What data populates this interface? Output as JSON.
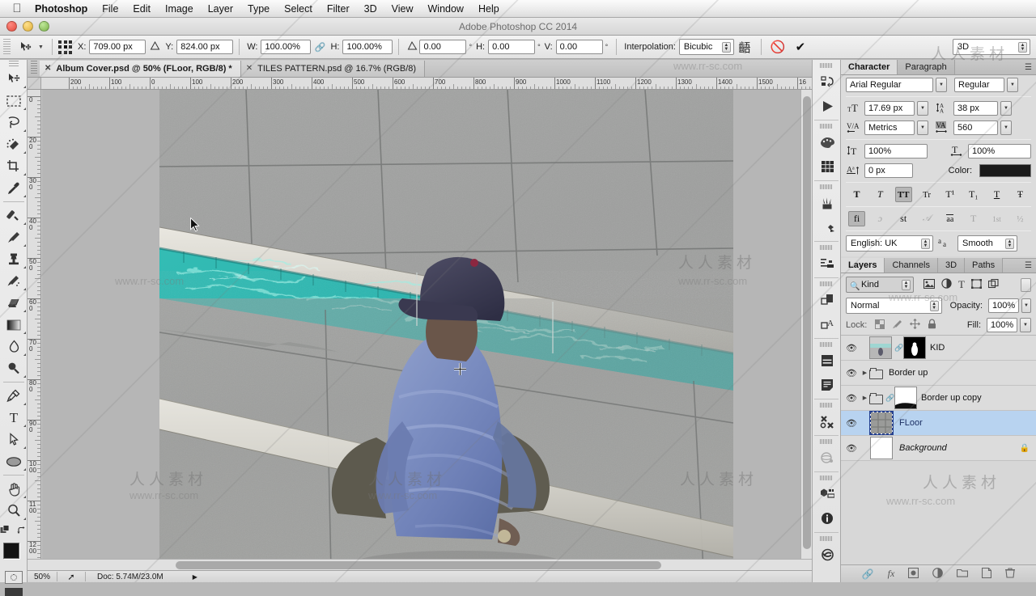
{
  "menubar": {
    "apple_icon": "apple-icon",
    "items": [
      {
        "label": "Photoshop",
        "bold": true
      },
      {
        "label": "File"
      },
      {
        "label": "Edit"
      },
      {
        "label": "Image"
      },
      {
        "label": "Layer"
      },
      {
        "label": "Type"
      },
      {
        "label": "Select"
      },
      {
        "label": "Filter"
      },
      {
        "label": "3D"
      },
      {
        "label": "View"
      },
      {
        "label": "Window"
      },
      {
        "label": "Help"
      }
    ]
  },
  "titlebar": {
    "app_title": "Adobe Photoshop CC 2014"
  },
  "options_bar": {
    "tool_icon": "move-tool-icon",
    "reference_point_icon": "reference-point-grid-icon",
    "x_label": "X:",
    "x_value": "709.00 px",
    "delta_icon": "delta-triangle-icon",
    "y_label": "Y:",
    "y_value": "824.00 px",
    "w_label": "W:",
    "w_value": "100.00%",
    "link_icon": "chain-link-icon",
    "h_label": "H:",
    "h_value": "100.00%",
    "angle_icon": "angle-icon",
    "angle_value": "0.00",
    "degree_symbol": "°",
    "skew_h_label": "H:",
    "skew_h_value": "0.00",
    "skew_v_label": "V:",
    "skew_v_value": "0.00",
    "interpolation_label": "Interpolation:",
    "interpolation_value": "Bicubic",
    "warp_icon": "warp-mode-icon",
    "cancel_icon": "cancel-transform-icon",
    "commit_icon": "commit-transform-icon",
    "workspace_label": "3D"
  },
  "toolbar": {
    "tools": [
      {
        "name": "move-tool",
        "icon": "move-arrow-icon"
      },
      {
        "name": "marquee-tool",
        "icon": "rect-marquee-icon"
      },
      {
        "name": "lasso-tool",
        "icon": "lasso-icon"
      },
      {
        "name": "quick-selection-tool",
        "icon": "quick-selection-icon"
      },
      {
        "name": "crop-tool",
        "icon": "crop-icon"
      },
      {
        "name": "eyedropper-tool",
        "icon": "eyedropper-icon"
      },
      {
        "name": "healing-brush-tool",
        "icon": "healing-brush-icon"
      },
      {
        "name": "brush-tool",
        "icon": "brush-icon"
      },
      {
        "name": "clone-stamp-tool",
        "icon": "clone-stamp-icon"
      },
      {
        "name": "history-brush-tool",
        "icon": "history-brush-icon"
      },
      {
        "name": "eraser-tool",
        "icon": "eraser-icon"
      },
      {
        "name": "gradient-tool",
        "icon": "gradient-icon"
      },
      {
        "name": "blur-tool",
        "icon": "blur-droplet-icon"
      },
      {
        "name": "dodge-tool",
        "icon": "dodge-icon"
      },
      {
        "name": "pen-tool",
        "icon": "pen-icon"
      },
      {
        "name": "type-tool",
        "icon": "type-T-icon"
      },
      {
        "name": "path-selection-tool",
        "icon": "path-arrow-icon"
      },
      {
        "name": "ellipse-tool",
        "icon": "ellipse-shape-icon"
      },
      {
        "name": "hand-tool",
        "icon": "hand-icon"
      },
      {
        "name": "zoom-tool",
        "icon": "magnifier-icon"
      }
    ],
    "edit_toolbar_icon": "edit-toolbar-icon",
    "swap_colors_icon": "swap-colors-icon",
    "foreground_color": "#131313",
    "background_color": "#ffffff",
    "quick_mask_icon": "quick-mask-icon",
    "screen_mode_icon": "screen-mode-icon"
  },
  "document": {
    "tabs": [
      {
        "title": "Album Cover.psd @ 50% (FLoor, RGB/8) *",
        "active": true,
        "close_icon": "close-tab-icon"
      },
      {
        "title": "TILES PATTERN.psd @ 16.7% (RGB/8)",
        "active": false,
        "close_icon": "close-tab-icon"
      }
    ],
    "ruler_top_labels": [
      "200",
      "100",
      "0",
      "100",
      "200",
      "300",
      "400",
      "500",
      "600",
      "700",
      "800",
      "900",
      "1000",
      "1100",
      "1200",
      "1300",
      "1400",
      "1500",
      "16"
    ],
    "ruler_left_labels": [
      "0",
      "200",
      "300",
      "400",
      "500",
      "600",
      "700",
      "800",
      "900",
      "1000",
      "1100",
      "1200"
    ],
    "status": {
      "zoom": "50%",
      "share_icon": "share-arrow-icon",
      "doc_info": "Doc: 5.74M/23.0M",
      "expand_icon": "status-expand-icon"
    },
    "cursor_icon": "arrow-cursor",
    "move_cursor_icon": "move-crosshair-cursor"
  },
  "icon_dock": {
    "icons": [
      {
        "name": "mini-bridge-icon"
      },
      {
        "name": "play-timeline-icon"
      },
      {
        "name": "color-palette-icon"
      },
      {
        "name": "swatches-grid-icon"
      },
      {
        "name": "brush-presets-icon"
      },
      {
        "name": "brush-tool-presets-icon"
      },
      {
        "name": "adjustments-icon"
      },
      {
        "name": "layer-comps-icon"
      },
      {
        "name": "character-styles-icon"
      },
      {
        "name": "properties-icon"
      },
      {
        "name": "notes-icon"
      },
      {
        "name": "tool-presets-icon"
      },
      {
        "name": "3d-orbit-icon"
      },
      {
        "name": "measurement-log-icon"
      },
      {
        "name": "info-icon"
      },
      {
        "name": "clone-source-icon"
      }
    ]
  },
  "character_panel": {
    "tabs": [
      {
        "label": "Character",
        "active": true
      },
      {
        "label": "Paragraph",
        "active": false
      }
    ],
    "menu_icon": "panel-menu-icon",
    "font_family": "Arial Regular",
    "font_style": "Regular",
    "font_size_icon": "font-size-icon",
    "font_size": "17.69 px",
    "leading_icon": "leading-icon",
    "leading": "38 px",
    "kerning_icon": "kerning-icon",
    "kerning": "Metrics",
    "tracking_icon": "tracking-icon",
    "tracking": "560",
    "vertical_scale_icon": "vertical-scale-icon",
    "vertical_scale": "100%",
    "horizontal_scale_icon": "horizontal-scale-icon",
    "horizontal_scale": "100%",
    "baseline_icon": "baseline-shift-icon",
    "baseline_shift": "0 px",
    "color_label": "Color:",
    "color_value": "#1a1a1a",
    "style_buttons": [
      {
        "name": "faux-bold",
        "glyph": "T",
        "active": false
      },
      {
        "name": "faux-italic",
        "glyph": "T",
        "active": false
      },
      {
        "name": "all-caps",
        "glyph": "TT",
        "active": true
      },
      {
        "name": "small-caps",
        "glyph": "Tr",
        "active": false
      },
      {
        "name": "superscript",
        "glyph": "T¹",
        "active": false
      },
      {
        "name": "subscript",
        "glyph": "T₁",
        "active": false
      },
      {
        "name": "underline",
        "glyph": "T",
        "active": false
      },
      {
        "name": "strikethrough",
        "glyph": "Ŧ",
        "active": false
      }
    ],
    "opentype_buttons": [
      {
        "name": "standard-ligatures",
        "glyph": "fi",
        "active": true
      },
      {
        "name": "contextual-alternates",
        "glyph": "ɔ",
        "active": false
      },
      {
        "name": "discretionary-ligatures",
        "glyph": "st",
        "active": false
      },
      {
        "name": "swash",
        "glyph": "𝒜",
        "active": false,
        "dim": true
      },
      {
        "name": "oldstyle",
        "glyph": "aa",
        "active": false
      },
      {
        "name": "stylistic-alternates",
        "glyph": "T",
        "active": false,
        "dim": true
      },
      {
        "name": "ordinals",
        "glyph": "1st",
        "active": false,
        "dim": true
      },
      {
        "name": "fractions",
        "glyph": "½",
        "active": false,
        "dim": true
      }
    ],
    "language": "English: UK",
    "antialias_icon": "anti-alias-icon",
    "antialias": "Smooth"
  },
  "layers_panel": {
    "tabs": [
      {
        "label": "Layers",
        "active": true
      },
      {
        "label": "Channels",
        "active": false
      },
      {
        "label": "3D",
        "active": false
      },
      {
        "label": "Paths",
        "active": false
      }
    ],
    "menu_icon": "panel-menu-icon",
    "filter_search_icon": "search-icon",
    "filter_kind": "Kind",
    "filter_icons": [
      "filter-pixel-icon",
      "filter-adjustment-icon",
      "filter-type-icon",
      "filter-shape-icon",
      "filter-smart-object-icon"
    ],
    "filter_toggle_icon": "filter-power-toggle-icon",
    "blend_mode": "Normal",
    "opacity_label": "Opacity:",
    "opacity_value": "100%",
    "lock_label": "Lock:",
    "lock_icons": [
      "lock-transparent-pixels-icon",
      "lock-image-pixels-icon",
      "lock-position-icon",
      "lock-all-icon"
    ],
    "fill_label": "Fill:",
    "fill_value": "100%",
    "layers": [
      {
        "name": "KID",
        "visible": true,
        "eye_icon": "eye-icon",
        "type": "image",
        "has_mask": true,
        "linked": true,
        "selected": false
      },
      {
        "name": "Border up",
        "visible": true,
        "eye_icon": "eye-icon",
        "type": "group",
        "expanded": false,
        "selected": false
      },
      {
        "name": "Border up copy",
        "visible": true,
        "eye_icon": "eye-icon",
        "type": "group",
        "expanded": false,
        "has_mask": true,
        "linked": true,
        "selected": false
      },
      {
        "name": "FLoor",
        "visible": true,
        "eye_icon": "eye-icon",
        "type": "image",
        "selected": true
      },
      {
        "name": "Background",
        "visible": true,
        "eye_icon": "eye-icon",
        "type": "background",
        "locked": true,
        "lock_icon": "lock-icon",
        "selected": false
      }
    ],
    "footer_icons": [
      {
        "name": "link-layers-icon"
      },
      {
        "name": "layer-styles-fx-icon"
      },
      {
        "name": "add-layer-mask-icon"
      },
      {
        "name": "adjustment-layer-icon"
      },
      {
        "name": "new-group-icon"
      },
      {
        "name": "new-layer-icon"
      },
      {
        "name": "delete-layer-icon"
      }
    ]
  },
  "watermarks": {
    "url": "www.rr-sc.com",
    "chinese": "人人素材"
  }
}
